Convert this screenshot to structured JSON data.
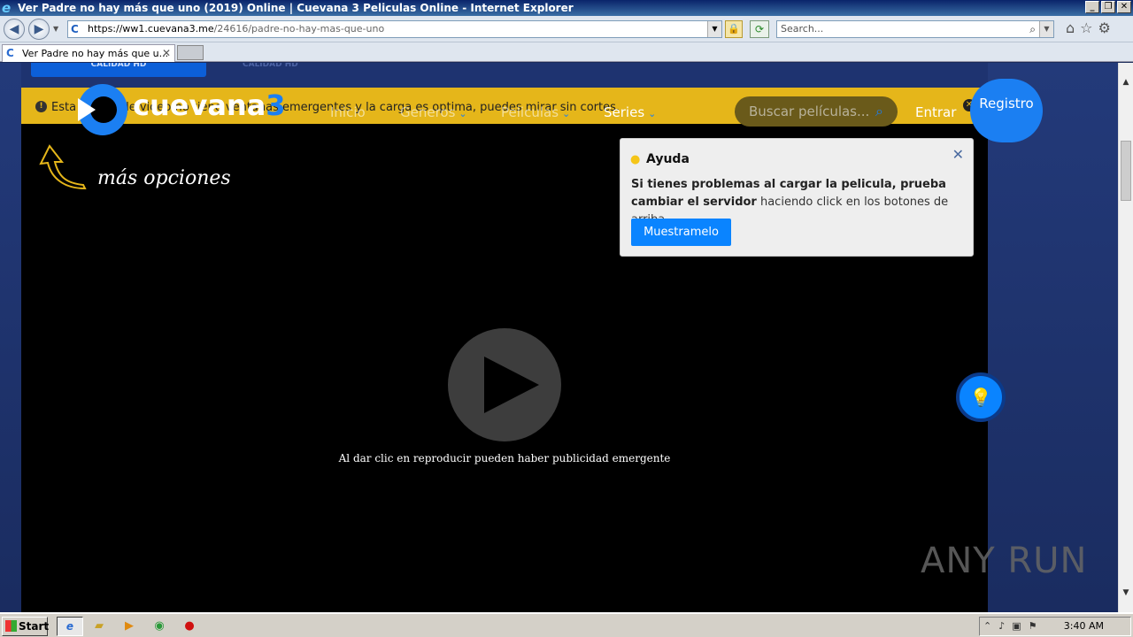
{
  "browser": {
    "window_title": "Ver Padre no hay más que uno (2019) Online | Cuevana 3 Peliculas Online - Internet Explorer",
    "url_host": "https://ww1.cuevana3.me",
    "url_path": "/24616/padre-no-hay-mas-que-uno",
    "search_placeholder": "Search...",
    "tab_title": "Ver Padre no hay más que u...",
    "window_buttons": [
      "_",
      "❐",
      "✕"
    ]
  },
  "site": {
    "quality_labels": [
      "CALIDAD HD",
      "CALIDAD HD"
    ],
    "notice_text": "Esta opción de video no tiene ventanas emergentes y la carga es optima, puedes mirar sin cortes.",
    "logo_word": "cuevana",
    "logo_number": "3",
    "nav": {
      "inicio": "Inicio",
      "generos": "Generos",
      "peliculas": "Peliculas",
      "series": "Series"
    },
    "search_placeholder": "Buscar películas...",
    "login": "Entrar",
    "register": "Registro",
    "more_options": "más opciones"
  },
  "help_popup": {
    "title": "Ayuda",
    "body_bold": "Si tienes problemas al cargar la pelicula, prueba cambiar el servidor",
    "body_rest": " haciendo click en los botones de arriba.",
    "button": "Muestramelo"
  },
  "player": {
    "message": "Al dar clic en reproducir pueden haber publicidad emergente"
  },
  "watermark": "ANY RUN",
  "taskbar": {
    "start": "Start",
    "clock": "3:40 AM"
  },
  "colors": {
    "brand_blue": "#1b7ff2",
    "notice_yellow": "#e5b61a",
    "button_blue": "#0a84ff"
  }
}
